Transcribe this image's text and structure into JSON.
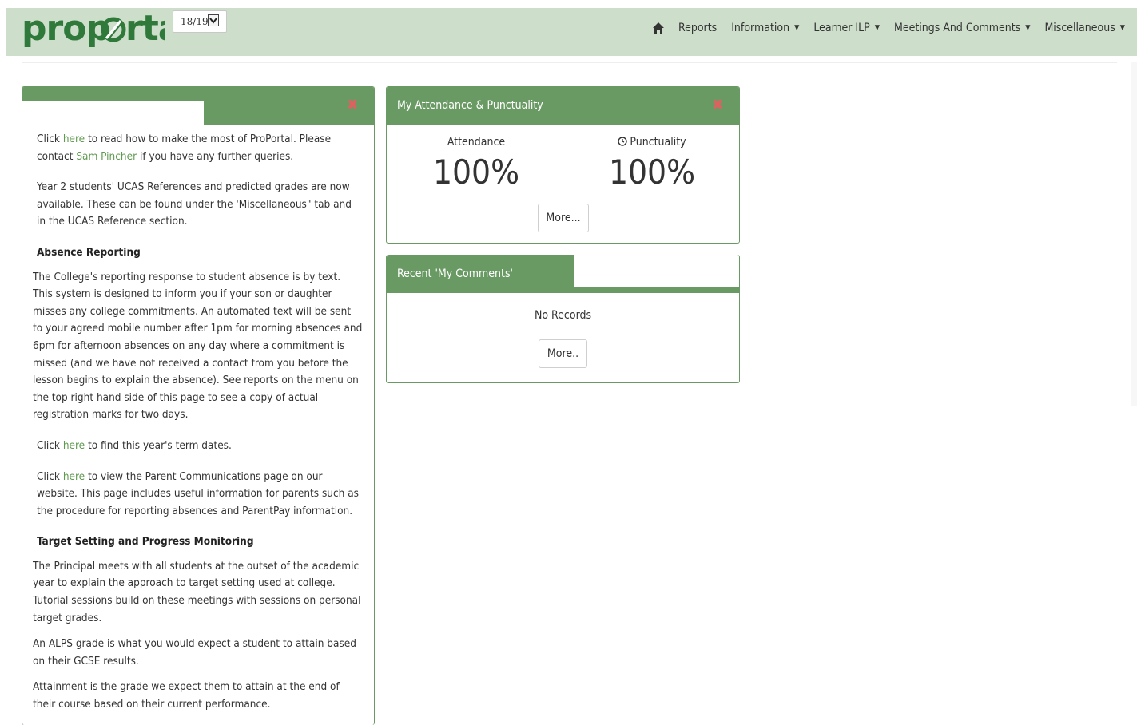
{
  "app": {
    "logo_text": "propørtal",
    "year_select": "18/19"
  },
  "nav": {
    "items": [
      {
        "label": "Reports",
        "dropdown": false
      },
      {
        "label": "Information",
        "dropdown": true
      },
      {
        "label": "Learner ILP",
        "dropdown": true
      },
      {
        "label": "Meetings And Comments",
        "dropdown": true
      },
      {
        "label": "Miscellaneous",
        "dropdown": true
      }
    ]
  },
  "left_panel": {
    "close_symbol": "✖",
    "p1_pre": " Click ",
    "p1_link": "here",
    "p1_mid": " to read how to make the most of ProPortal. Please contact ",
    "p1_link2": "Sam Pincher",
    "p1_post": " if you have any further queries.",
    "p2": "Year 2 students' UCAS References and predicted grades are now available. These can be found under the 'Miscellaneous\" tab and in the UCAS Reference section.",
    "h_absence": "Absence Reporting",
    "p_absence": "The College's reporting response to student absence is by text. This system is designed to inform you if your son or daughter misses any college commitments. An automated text will be sent to your agreed mobile number after 1pm for morning absences and 6pm for afternoon absences on any day where a commitment is missed (and we have not received a contact from you before the lesson begins to explain the absence). See reports on the menu on the top right hand side of this page to see a copy of actual registration marks for two days.",
    "p_term_pre": "Click ",
    "p_term_link": "here",
    "p_term_post": " to find this year's term dates.",
    "p_parent_pre": "Click ",
    "p_parent_link": "here",
    "p_parent_post": " to view the Parent Communications page on our website. This page includes useful information for parents such as the procedure for reporting absences and ParentPay information.",
    "h_target": "Target Setting and Progress Monitoring",
    "p_target": "The Principal meets with all students at the outset of the academic year to explain the approach to target setting used at college. Tutorial sessions build on these meetings with sessions on personal target grades.",
    "p_alps": "An ALPS grade is what you would expect a student to attain based on their GCSE results.",
    "p_attain": "Attainment is the grade we expect them to attain at the end of their course based on their current performance."
  },
  "attendance_panel": {
    "title": "My Attendance & Punctuality",
    "close_symbol": "✖",
    "attendance_label": "Attendance",
    "attendance_value": "100%",
    "punctuality_label": "Punctuality",
    "punctuality_value": "100%",
    "more_label": "More..."
  },
  "comments_panel": {
    "title": "Recent 'My Comments'",
    "empty_text": "No Records",
    "more_label": "More.."
  },
  "colors": {
    "nav_bg": "#cddecb",
    "panel_green": "#6a9a64",
    "link_green": "#5f9a4f",
    "close_red": "#e06060"
  }
}
